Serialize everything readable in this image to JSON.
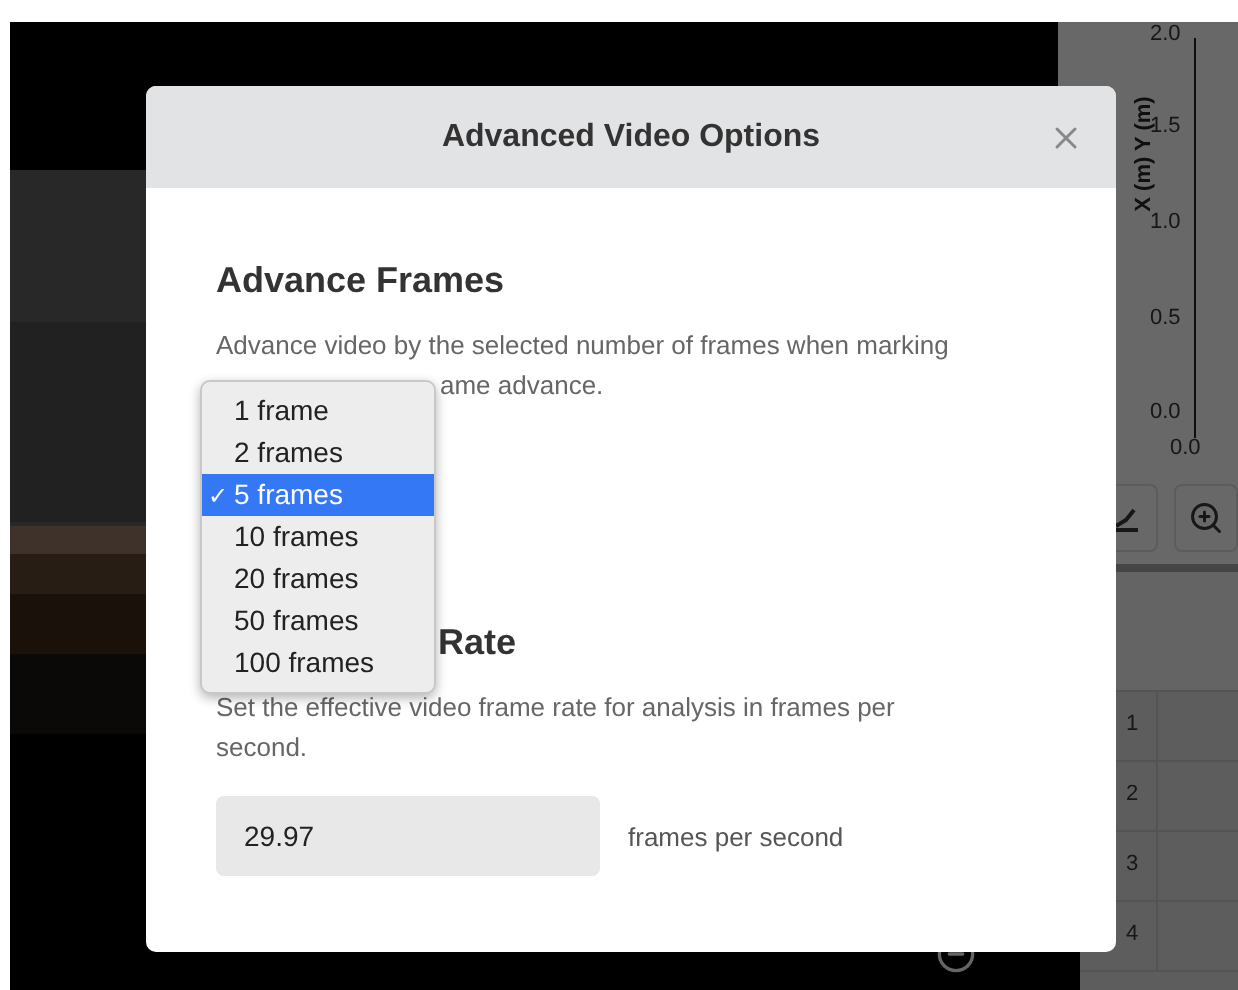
{
  "background": {
    "chart": {
      "y_ticks": [
        "2.0",
        "1.5",
        "1.0",
        "0.5",
        "0.0"
      ],
      "x_ticks": [
        "0.0"
      ],
      "axis_labels": [
        "X (m)",
        "Y (m)"
      ]
    },
    "table": {
      "row_numbers": [
        "1",
        "2",
        "3",
        "4"
      ]
    }
  },
  "dialog": {
    "title": "Advanced Video Options",
    "sections": [
      {
        "heading": "Advance Frames",
        "description_lines": [
          "Advance video by the selected number of frames when marking",
          "ame advance."
        ]
      },
      {
        "heading": "Rate",
        "description_lines": [
          "Set the effective video frame rate for analysis in frames per",
          "second."
        ]
      }
    ],
    "dropdown": {
      "check": "✓",
      "options": [
        {
          "label": "1 frame",
          "selected": false
        },
        {
          "label": "2 frames",
          "selected": false
        },
        {
          "label": "5 frames",
          "selected": true
        },
        {
          "label": "10 frames",
          "selected": false
        },
        {
          "label": "20 frames",
          "selected": false
        },
        {
          "label": "50 frames",
          "selected": false
        },
        {
          "label": "100 frames",
          "selected": false
        }
      ]
    },
    "frame_rate": {
      "value": "29.97",
      "unit": "frames per second"
    }
  }
}
